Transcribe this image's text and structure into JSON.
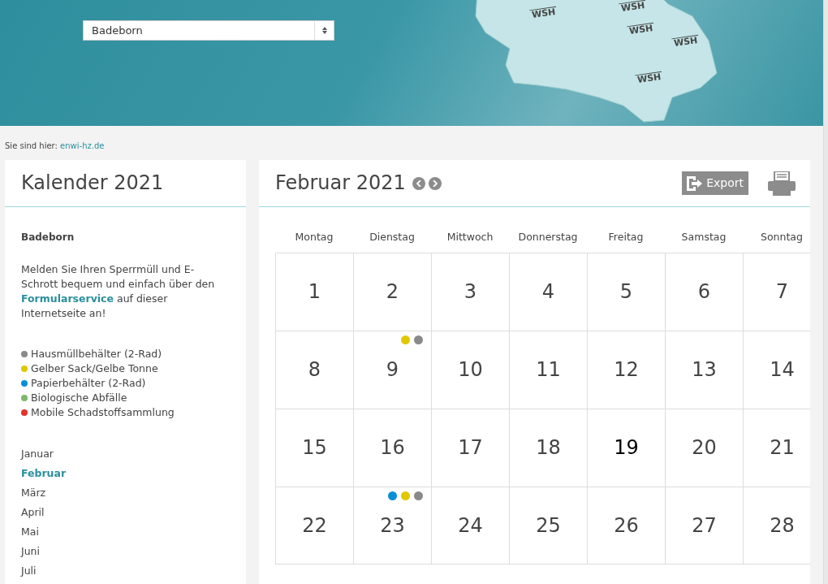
{
  "header": {
    "location_select": {
      "value": "Badeborn"
    },
    "map_markers": [
      {
        "label": "WSH"
      },
      {
        "label": "WSH"
      },
      {
        "label": "WSH"
      },
      {
        "label": "WSH"
      },
      {
        "label": "WSH"
      }
    ]
  },
  "breadcrumb": {
    "label": "Sie sind hier:",
    "link": "enwi-hz.de"
  },
  "sidebar": {
    "title": "Kalender 2021",
    "place": "Badeborn",
    "notice": "Melden Sie Ihren Sperrmüll und E-Schrott bequem und einfach über den **Formularservice** auf dieser Internetseite an!",
    "legend": [
      {
        "label": "Hausmüllbehälter (2-Rad)",
        "color": "#8a8a8a"
      },
      {
        "label": "Gelber Sack/Gelbe Tonne",
        "color": "#e0c800"
      },
      {
        "label": "Papierbehälter (2-Rad)",
        "color": "#0a8fd4"
      },
      {
        "label": "Biologische Abfälle",
        "color": "#7cb86a"
      },
      {
        "label": "Mobile Schadstoffsammlung",
        "color": "#e2332a"
      }
    ],
    "months": [
      {
        "label": "Januar",
        "selected": false
      },
      {
        "label": "Februar",
        "selected": true
      },
      {
        "label": "März",
        "selected": false
      },
      {
        "label": "April",
        "selected": false
      },
      {
        "label": "Mai",
        "selected": false
      },
      {
        "label": "Juni",
        "selected": false
      },
      {
        "label": "Juli",
        "selected": false
      }
    ]
  },
  "calendar": {
    "title": "Februar 2021",
    "export_label": "Export",
    "weekdays": [
      "Montag",
      "Dienstag",
      "Mittwoch",
      "Donnerstag",
      "Freitag",
      "Samstag",
      "Sonntag"
    ],
    "weeks": [
      [
        {
          "day": "1",
          "today": false
        },
        {
          "day": "2",
          "today": false
        },
        {
          "day": "3",
          "today": false
        },
        {
          "day": "4",
          "today": false
        },
        {
          "day": "5",
          "today": false
        },
        {
          "day": "6",
          "today": false
        },
        {
          "day": "7",
          "today": false
        }
      ],
      [
        {
          "day": "8",
          "today": false
        },
        {
          "day": "9",
          "today": false,
          "dots": [
            {
              "color": "#e0c800"
            },
            {
              "color": "#8a8a8a"
            }
          ]
        },
        {
          "day": "10",
          "today": false
        },
        {
          "day": "11",
          "today": false
        },
        {
          "day": "12",
          "today": false
        },
        {
          "day": "13",
          "today": false
        },
        {
          "day": "14",
          "today": false
        }
      ],
      [
        {
          "day": "15",
          "today": false
        },
        {
          "day": "16",
          "today": false
        },
        {
          "day": "17",
          "today": false
        },
        {
          "day": "18",
          "today": false
        },
        {
          "day": "19",
          "today": true
        },
        {
          "day": "20",
          "today": false
        },
        {
          "day": "21",
          "today": false
        }
      ],
      [
        {
          "day": "22",
          "today": false
        },
        {
          "day": "23",
          "today": false,
          "dots": [
            {
              "color": "#0a8fd4"
            },
            {
              "color": "#e0c800"
            },
            {
              "color": "#8a8a8a"
            }
          ]
        },
        {
          "day": "24",
          "today": false
        },
        {
          "day": "25",
          "today": false
        },
        {
          "day": "26",
          "today": false
        },
        {
          "day": "27",
          "today": false
        },
        {
          "day": "28",
          "today": false
        }
      ]
    ]
  }
}
